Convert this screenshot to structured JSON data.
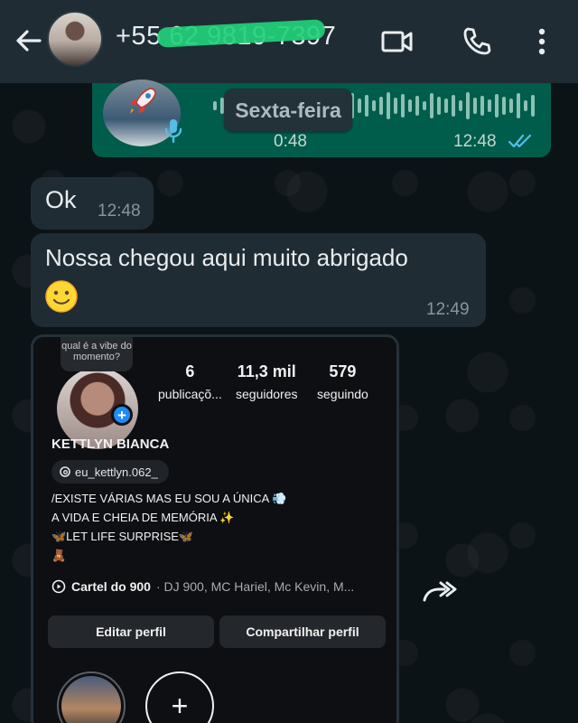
{
  "header": {
    "phone_number": "+55 62 9819-7397",
    "icons": [
      "back-arrow-icon",
      "video-call-icon",
      "voice-call-icon",
      "more-vertical-icon"
    ]
  },
  "voice_message": {
    "day_label": "Sexta-feira",
    "duration": "0:48",
    "time": "12:48",
    "status": "read",
    "accent_color": "#005c4b",
    "tick_color": "#53bdeb"
  },
  "messages": [
    {
      "text": "Ok",
      "time": "12:48",
      "emoji": ""
    },
    {
      "text": "Nossa chegou aqui muito abrigado",
      "time": "12:49",
      "emoji": "🙂"
    }
  ],
  "instagram_card": {
    "note": "qual é a vibe do momento?",
    "stats": [
      {
        "value": "6",
        "label": "publicaçõ..."
      },
      {
        "value": "11,3 mil",
        "label": "seguidores"
      },
      {
        "value": "579",
        "label": "seguindo"
      }
    ],
    "name": "KETTLYN BIANCA",
    "threads_handle": "eu_kettlyn.062_",
    "bio": [
      "/EXISTE VÁRIAS MAS EU SOU A ÚNICA 💨",
      "A VIDA E CHEIA DE MEMÓRIA ✨",
      "🦋LET LIFE SURPRISE🦋",
      "🧸"
    ],
    "music_title": "Cartel do 900",
    "music_artists": "· DJ 900, MC Hariel, Mc Kevin, M...",
    "buttons": {
      "edit": "Editar perfil",
      "share": "Compartilhar perfil"
    },
    "new_highlight": "+"
  }
}
